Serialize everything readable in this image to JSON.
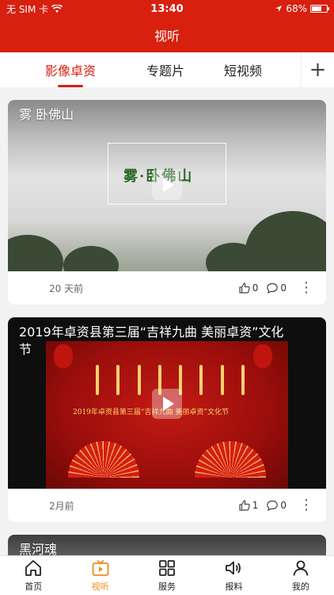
{
  "status_bar": {
    "carrier": "无 SIM 卡",
    "time": "13:40",
    "battery": "68%",
    "battery_level": 0.68
  },
  "header": {
    "title": "视听"
  },
  "tabs": [
    {
      "label": "影像卓资",
      "active": true
    },
    {
      "label": "专题片",
      "active": false
    },
    {
      "label": "短视频",
      "active": false
    }
  ],
  "tabs_add_label": "+",
  "feed": [
    {
      "title": "雾 卧佛山",
      "overlay_text": "雾·卧佛山",
      "time_ago": "20 天前",
      "likes": "0",
      "comments": "0"
    },
    {
      "title": "2019年卓资县第三届“吉祥九曲 美丽卓资”文化节",
      "overlay_text": "2019年卓资县第三届“吉祥九曲 美丽卓资”文化节",
      "time_ago": "2月前",
      "likes": "1",
      "comments": "0"
    },
    {
      "title": "黑河魂"
    }
  ],
  "bottom_nav": [
    {
      "label": "首页",
      "icon": "home-icon",
      "active": false
    },
    {
      "label": "视听",
      "icon": "video-icon",
      "active": true
    },
    {
      "label": "服务",
      "icon": "grid-icon",
      "active": false
    },
    {
      "label": "报料",
      "icon": "speaker-icon",
      "active": false
    },
    {
      "label": "我的",
      "icon": "user-icon",
      "active": false
    }
  ],
  "colors": {
    "brand_red": "#d8200f",
    "active_nav": "#ef8a1c"
  }
}
